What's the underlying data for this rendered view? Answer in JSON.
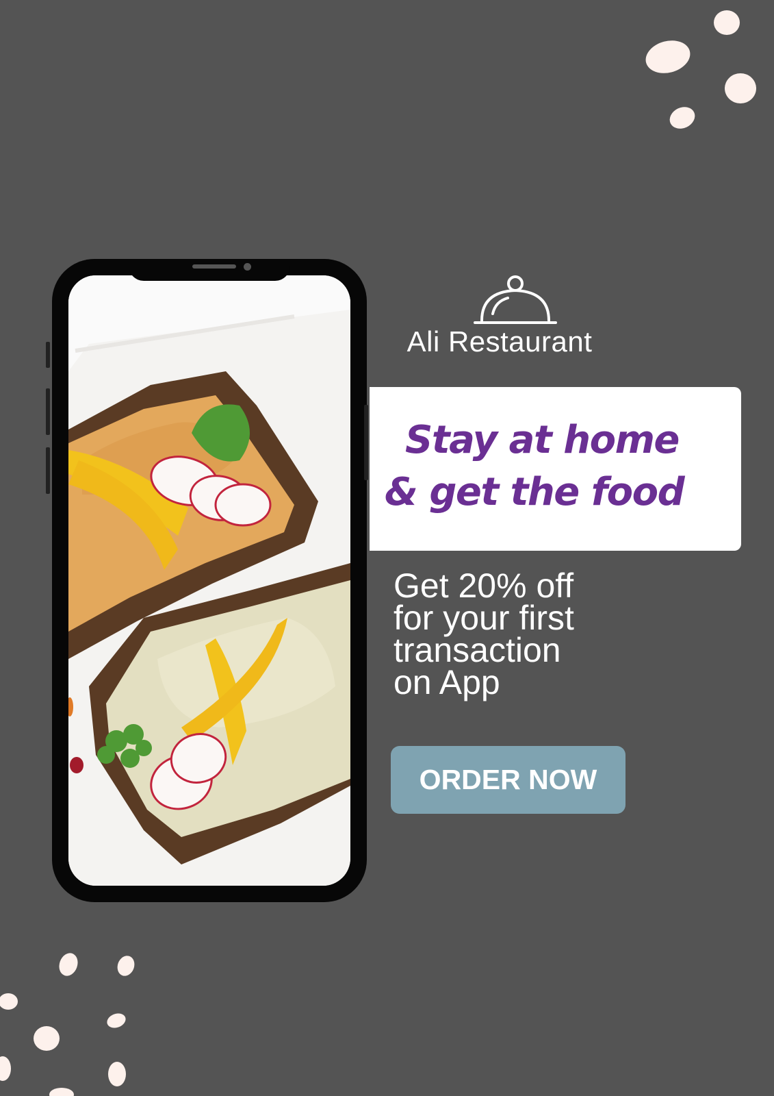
{
  "brand": {
    "name": "Ali Restaurant",
    "logo_icon": "cloche-icon"
  },
  "banner": {
    "headline_line1": "Stay at home",
    "headline_line2": "& get the food"
  },
  "offer": {
    "line1": "Get 20% off",
    "line2": "for your first",
    "line3": "transaction",
    "line4": "on App"
  },
  "cta": {
    "label": "ORDER NOW"
  },
  "colors": {
    "background": "#545454",
    "headline": "#6a2f93",
    "button": "#7fa3b1",
    "dots": "#fdf1ec"
  }
}
